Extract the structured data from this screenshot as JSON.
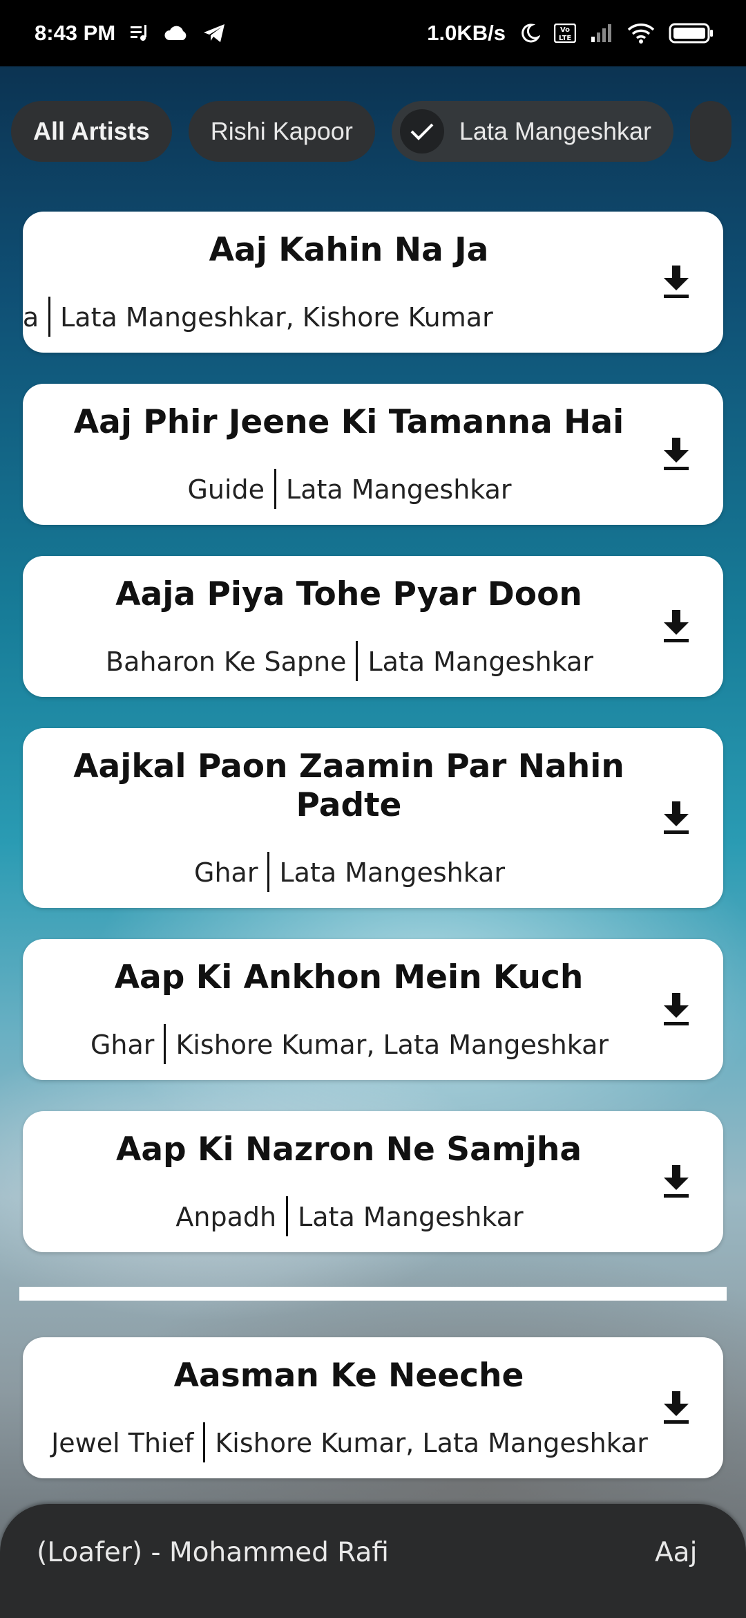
{
  "status_bar": {
    "time": "8:43 PM",
    "network_speed": "1.0KB/s",
    "icons": [
      "music-notification-icon",
      "cloud-icon",
      "telegram-icon",
      "moon-icon",
      "volte-icon",
      "signal-icon",
      "wifi-icon",
      "battery-icon"
    ],
    "volte_label": "Vo LTE"
  },
  "chips": [
    {
      "label": "All Artists",
      "selected": false
    },
    {
      "label": "Rishi Kapoor",
      "selected": false
    },
    {
      "label": "Lata Mangeshkar",
      "selected": true
    }
  ],
  "songs": [
    {
      "title": "Aaj Kahin Na Ja",
      "movie": "Rafoo Chakkar Wala",
      "artists": "Lata Mangeshkar, Kishore Kumar",
      "movie_visible": "ala"
    },
    {
      "title": "Aaj Phir Jeene Ki Tamanna Hai",
      "movie": "Guide",
      "artists": "Lata Mangeshkar"
    },
    {
      "title": "Aaja Piya Tohe Pyar Doon",
      "movie": "Baharon Ke Sapne",
      "artists": "Lata Mangeshkar"
    },
    {
      "title": "Aajkal Paon Zaamin Par Nahin Padte",
      "movie": "Ghar",
      "artists": "Lata Mangeshkar"
    },
    {
      "title": "Aap Ki Ankhon Mein Kuch",
      "movie": "Ghar",
      "artists": "Kishore Kumar, Lata Mangeshkar"
    },
    {
      "title": "Aap Ki Nazron Ne Samjha",
      "movie": "Anpadh",
      "artists": "Lata Mangeshkar"
    },
    {
      "title": "Aasman Ke Neeche",
      "movie": "Jewel Thief",
      "artists": "Kishore Kumar, Lata Mangeshkar"
    }
  ],
  "now_playing": {
    "text": "ai (Loafer) - Mohammed Rafi",
    "next_text": "Aaj"
  },
  "colors": {
    "card": "#ffffff",
    "chip": "#2f3133",
    "now_playing_bar": "#2a2b2c",
    "status_bar": "#000000"
  }
}
